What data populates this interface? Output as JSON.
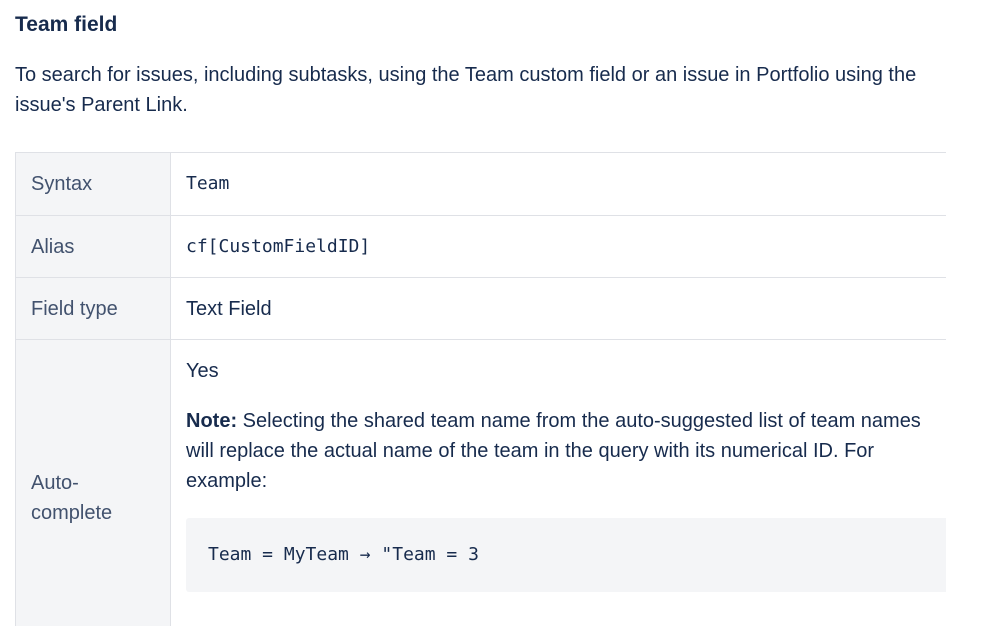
{
  "heading": "Team field",
  "intro": "To search for issues, including subtasks, using the Team custom field or an issue in Portfolio using the issue's Parent Link.",
  "table": {
    "rows": [
      {
        "label": "Syntax",
        "value": "Team"
      },
      {
        "label": "Alias",
        "value": "cf[CustomFieldID]"
      },
      {
        "label": "Field type",
        "value": "Text Field"
      },
      {
        "label": "Auto-complete",
        "value": "Yes",
        "note_label": "Note:",
        "note_line1": " Selecting the shared team name from the auto-suggested list of team names",
        "note_line2": "will replace the actual name of the team in the query with its numerical ID. For",
        "note_line3": "example:",
        "code": "Team = MyTeam → \"Team = 3"
      }
    ]
  }
}
